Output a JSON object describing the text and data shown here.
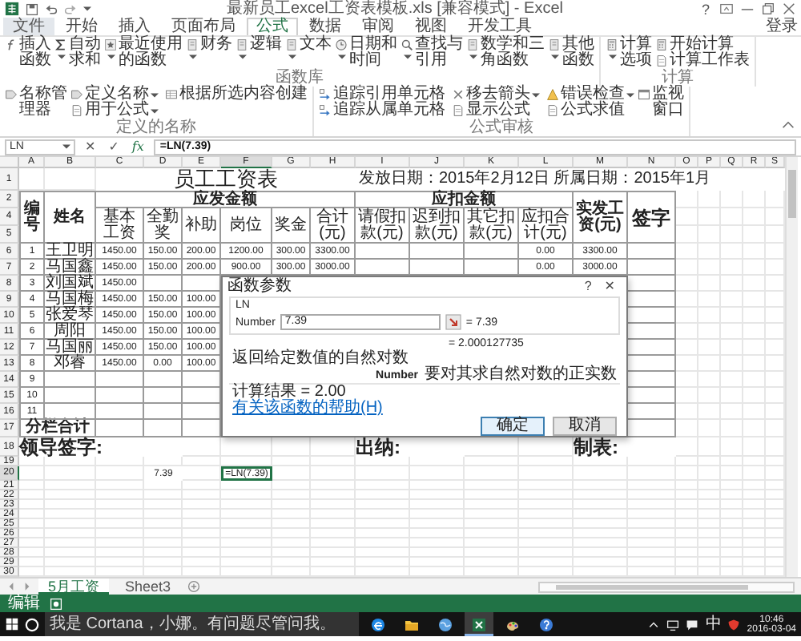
{
  "title_bar": {
    "title": "最新员工excel工资表模板.xls [兼容模式] - Excel",
    "help": "?"
  },
  "tabs": [
    {
      "label": "文件",
      "kind": "file",
      "selected": false
    },
    {
      "label": "开始",
      "kind": "tab",
      "selected": false
    },
    {
      "label": "插入",
      "kind": "tab",
      "selected": false
    },
    {
      "label": "页面布局",
      "kind": "tab",
      "selected": false
    },
    {
      "label": "公式",
      "kind": "tab",
      "selected": true
    },
    {
      "label": "数据",
      "kind": "tab",
      "selected": false
    },
    {
      "label": "审阅",
      "kind": "tab",
      "selected": false
    },
    {
      "label": "视图",
      "kind": "tab",
      "selected": false
    },
    {
      "label": "开发工具",
      "kind": "tab",
      "selected": false
    }
  ],
  "account": {
    "label": "登录"
  },
  "ribbon": {
    "groups": [
      {
        "label": "函数库",
        "items": [
          {
            "label": "插入函数",
            "kind": "large",
            "dropdown": false
          },
          {
            "label": "自动求和",
            "kind": "large",
            "dropdown": true
          },
          {
            "label": "最近使用的函数",
            "kind": "large",
            "dropdown": true
          },
          {
            "label": "财务",
            "kind": "large",
            "dropdown": true
          },
          {
            "label": "逻辑",
            "kind": "large",
            "dropdown": true
          },
          {
            "label": "文本",
            "kind": "large",
            "dropdown": true
          },
          {
            "label": "日期和时间",
            "kind": "large",
            "dropdown": true
          },
          {
            "label": "查找与引用",
            "kind": "large",
            "dropdown": true
          },
          {
            "label": "数学和三角函数",
            "kind": "large",
            "dropdown": true
          },
          {
            "label": "其他函数",
            "kind": "large",
            "dropdown": true
          }
        ]
      },
      {
        "label": "定义的名称",
        "items": [
          {
            "label": "名称管理器",
            "kind": "large",
            "dropdown": false
          },
          {
            "label": "定义名称",
            "kind": "small",
            "dropdown": true
          },
          {
            "label": "用于公式",
            "kind": "small",
            "dropdown": true
          },
          {
            "label": "根据所选内容创建",
            "kind": "small",
            "dropdown": false
          }
        ]
      },
      {
        "label": "公式审核",
        "items": [
          {
            "label": "追踪引用单元格",
            "kind": "small",
            "dropdown": false
          },
          {
            "label": "追踪从属单元格",
            "kind": "small",
            "dropdown": false
          },
          {
            "label": "移去箭头",
            "kind": "small",
            "dropdown": true
          },
          {
            "label": "显示公式",
            "kind": "small",
            "dropdown": false
          },
          {
            "label": "错误检查",
            "kind": "small",
            "dropdown": true
          },
          {
            "label": "公式求值",
            "kind": "small",
            "dropdown": false
          },
          {
            "label": "监视窗口",
            "kind": "large",
            "dropdown": false
          }
        ]
      },
      {
        "label": "计算",
        "items": [
          {
            "label": "计算选项",
            "kind": "large",
            "dropdown": true
          },
          {
            "label": "开始计算",
            "kind": "small",
            "dropdown": false
          },
          {
            "label": "计算工作表",
            "kind": "small",
            "dropdown": false
          }
        ]
      }
    ]
  },
  "formula_bar": {
    "name_box": "LN",
    "cancel": "✕",
    "enter": "✓",
    "function": "fx",
    "formula": "=LN(7.39)"
  },
  "sheet": {
    "columns": [
      "A",
      "B",
      "C",
      "D",
      "E",
      "F",
      "G",
      "H",
      "I",
      "J",
      "K",
      "L",
      "M",
      "N",
      "O",
      "P",
      "Q",
      "R",
      "S"
    ],
    "row_numbers": [
      "1",
      "2",
      "4",
      "5",
      "6",
      "7",
      "8",
      "9",
      "10",
      "11",
      "12",
      "13",
      "14",
      "15",
      "16",
      "17",
      "18",
      "19",
      "20",
      "21",
      "22",
      "23",
      "24",
      "25",
      "26",
      "27",
      "28",
      "29",
      "30"
    ],
    "title": "员工工资表",
    "issue_info": "发放日期：2015年2月12日 所属日期：2015年1月",
    "header": {
      "number": "编号",
      "name": "姓名",
      "groups": [
        {
          "label": "应发金额",
          "columns": [
            "基本工资",
            "全勤奖",
            "补助",
            "岗位",
            "奖金",
            "合计(元)"
          ]
        },
        {
          "label": "应扣金额",
          "columns": [
            "请假扣款(元)",
            "迟到扣款(元)",
            "其它扣款(元)",
            "应扣合计(元)"
          ]
        }
      ],
      "net_pay": "实发工资(元)",
      "signature": "签字"
    },
    "records": [
      {
        "A": "1",
        "B": "王卫明",
        "C": "1450.00",
        "D": "150.00",
        "E": "200.00",
        "F": "1200.00",
        "G": "300.00",
        "H": "3300.00",
        "L": "0.00",
        "M": "3300.00"
      },
      {
        "A": "2",
        "B": "马国鑫",
        "C": "1450.00",
        "D": "150.00",
        "E": "200.00",
        "F": "900.00",
        "G": "300.00",
        "H": "3000.00",
        "L": "0.00",
        "M": "3000.00"
      },
      {
        "A": "3",
        "B": "刘国斌",
        "C": "1450.00"
      },
      {
        "A": "4",
        "B": "马国梅",
        "C": "1450.00",
        "D": "150.00",
        "E": "100.00"
      },
      {
        "A": "5",
        "B": "张爱琴",
        "C": "1450.00",
        "D": "150.00",
        "E": "100.00"
      },
      {
        "A": "6",
        "B": "周阳",
        "C": "1450.00",
        "D": "150.00",
        "E": "100.00"
      },
      {
        "A": "7",
        "B": "马国丽",
        "C": "1450.00",
        "D": "150.00",
        "E": "100.00"
      },
      {
        "A": "8",
        "B": "邓睿",
        "C": "1450.00",
        "D": "0.00",
        "E": "100.00"
      },
      {
        "A": "9"
      },
      {
        "A": "10"
      },
      {
        "A": "11"
      }
    ],
    "subtotal_label": "分栏合计",
    "signatures": [
      "领导签字:",
      "出纳:",
      "制表:"
    ],
    "cells": {
      "D": {
        "text": "7.39",
        "selected": false
      },
      "F": {
        "text": "=LN(7.39)",
        "selected": true
      }
    }
  },
  "dialog": {
    "title": "函数参数",
    "help": "?",
    "close": "✕",
    "function_name": "LN",
    "argument": {
      "label": "Number",
      "value": "7.39",
      "result": "= 7.39"
    },
    "formula_result": "= 2.000127735",
    "description": "返回给定数值的自然对数",
    "argument_help": {
      "label": "Number",
      "text": "要对其求自然对数的正实数"
    },
    "calc_result": "计算结果 =  2.00",
    "help_link": "有关该函数的帮助(H)",
    "buttons": [
      {
        "label": "确定",
        "default": true
      },
      {
        "label": "取消",
        "default": false
      }
    ]
  },
  "sheet_tabs": {
    "tabs": [
      {
        "label": "5月工资",
        "selected": true
      },
      {
        "label": "Sheet3",
        "selected": false
      }
    ]
  },
  "status_bar": {
    "mode": "编辑"
  },
  "taskbar": {
    "search": {
      "placeholder": "我是 Cortana，小娜。有问题尽管问我。"
    },
    "apps": [
      {
        "active": false
      },
      {
        "active": false
      },
      {
        "active": false
      },
      {
        "active": true
      },
      {
        "active": false
      },
      {
        "active": false
      }
    ],
    "tray": {
      "ime": "中",
      "time": "10:46",
      "date": "2016-03-04"
    }
  }
}
